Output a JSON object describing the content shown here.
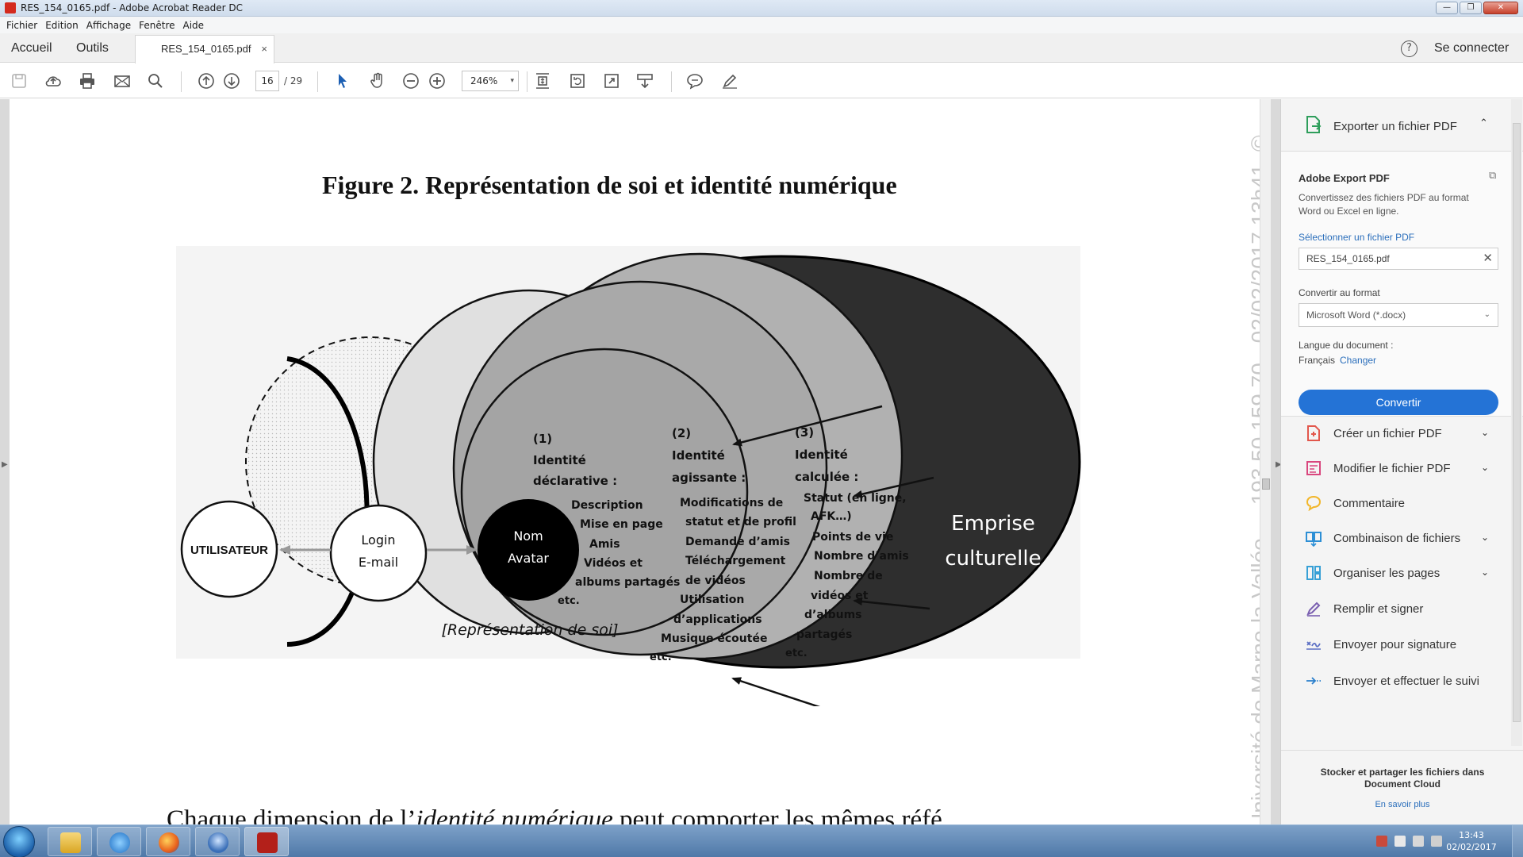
{
  "window": {
    "title": "RES_154_0165.pdf - Adobe Acrobat Reader DC",
    "buttons": {
      "minimize": "—",
      "maximize": "❐",
      "close": "✕"
    }
  },
  "menu": [
    "Fichier",
    "Edition",
    "Affichage",
    "Fenêtre",
    "Aide"
  ],
  "tabs": {
    "home": "Accueil",
    "tools": "Outils",
    "document": "RES_154_0165.pdf",
    "close": "×",
    "help": "?",
    "connect": "Se connecter"
  },
  "toolbar": {
    "page_current": "16",
    "page_total": "/ 29",
    "zoom": "246%",
    "zoom_caret": "▾",
    "icons": [
      "save-icon",
      "upload-icon",
      "print-icon",
      "mail-icon",
      "search-icon",
      "page-up-icon",
      "page-down-icon",
      "select-arrow-icon",
      "hand-icon",
      "zoom-out-icon",
      "zoom-in-icon",
      "fit-page-icon",
      "rotate-icon",
      "full-screen-icon",
      "scroll-mode-icon",
      "comment-icon",
      "sign-pen-icon"
    ]
  },
  "document": {
    "figure_title": "Figure 2. Représentation de soi et identité numérique",
    "bottom_text_before": "Chaque dimension de l’",
    "bottom_text_italic": "identité numérique",
    "bottom_text_after": " peut comporter les mêmes réfé",
    "watermark": "Université de Marne-la-Vallée -   - 193.50.159.70 - 02/02/2017 13h41. ©",
    "diagram": {
      "utilisateur": "UTILISATEUR",
      "login": "Login",
      "email": "E-mail",
      "nom": "Nom",
      "avatar": "Avatar",
      "representation": "[Représentation de soi]",
      "emprise_1": "Emprise",
      "emprise_2": "culturelle",
      "col1": [
        "(1)",
        "Identité",
        "déclarative :",
        "Description",
        "Mise en page",
        "Amis",
        "Vidéos et",
        "albums partagés",
        "etc."
      ],
      "col2": [
        "(2)",
        "Identité",
        "agissante :",
        "Modifications de",
        "statut et de profil",
        "Demande d’amis",
        "Téléchargement",
        "de vidéos",
        "Utilisation",
        "d’applications",
        "Musique écoutée",
        "etc."
      ],
      "col3": [
        "(3)",
        "Identité",
        "calculée :",
        "Statut (en ligne,",
        "AFK…)",
        "Points de vie",
        "Nombre d’amis",
        "Nombre de",
        "vidéos et",
        "d’albums",
        "partagés",
        "etc."
      ]
    }
  },
  "panel": {
    "export_header": "Exporter un fichier PDF",
    "export_chevron": "⌃",
    "box_title": "Adobe Export PDF",
    "box_desc": "Convertissez des fichiers PDF au format Word ou Excel en ligne.",
    "select_link": "Sélectionner un fichier PDF",
    "file_name": "RES_154_0165.pdf",
    "file_clear": "✕",
    "format_label": "Convertir au format",
    "format_value": "Microsoft Word (*.docx)",
    "format_caret": "⌄",
    "lang_label": "Langue du document :",
    "lang_value": "Français",
    "lang_change": "Changer",
    "convert": "Convertir",
    "tools": [
      {
        "label": "Créer un fichier PDF",
        "icon": "create-pdf-icon",
        "color": "#e2574c",
        "chevron": "⌄"
      },
      {
        "label": "Modifier le fichier PDF",
        "icon": "edit-pdf-icon",
        "color": "#d9467e",
        "chevron": "⌄"
      },
      {
        "label": "Commentaire",
        "icon": "comment-bubble-icon",
        "color": "#f2b629",
        "chevron": ""
      },
      {
        "label": "Combinaison de fichiers",
        "icon": "combine-files-icon",
        "color": "#2d8fd5",
        "chevron": "⌄"
      },
      {
        "label": "Organiser les pages",
        "icon": "organize-pages-icon",
        "color": "#37a0d6",
        "chevron": "⌄"
      },
      {
        "label": "Remplir et signer",
        "icon": "fill-sign-icon",
        "color": "#7a5fb0",
        "chevron": ""
      },
      {
        "label": "Envoyer pour signature",
        "icon": "send-signature-icon",
        "color": "#5b6fc4",
        "chevron": ""
      },
      {
        "label": "Envoyer et effectuer le suivi",
        "icon": "send-track-icon",
        "color": "#2a7fcc",
        "chevron": ""
      }
    ],
    "footer_title": "Stocker et partager les fichiers dans Document Cloud",
    "footer_link": "En savoir plus"
  },
  "taskbar": {
    "time": "13:43",
    "date": "02/02/2017",
    "apps": [
      "file-explorer-icon",
      "internet-explorer-icon",
      "firefox-icon",
      "thunderbird-icon",
      "acrobat-icon"
    ]
  }
}
